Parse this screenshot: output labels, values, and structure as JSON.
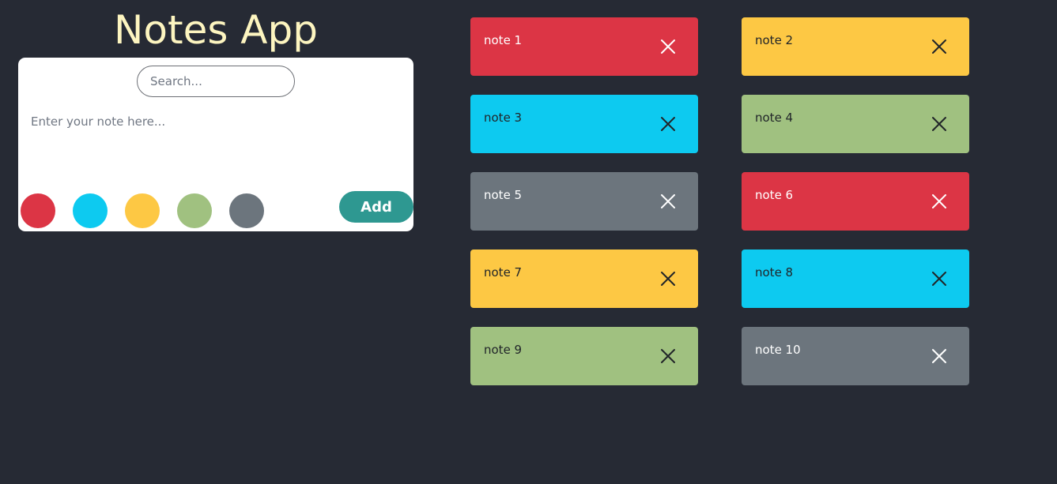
{
  "app": {
    "title": "Notes App"
  },
  "editor": {
    "search_placeholder": "Search...",
    "note_placeholder": "Enter your note here...",
    "add_label": "Add",
    "swatches": [
      {
        "name": "red",
        "color": "#dc3545"
      },
      {
        "name": "cyan",
        "color": "#0dcaf0"
      },
      {
        "name": "yellow",
        "color": "#fdc844"
      },
      {
        "name": "green",
        "color": "#a0c180"
      },
      {
        "name": "gray",
        "color": "#6c757d"
      }
    ]
  },
  "notes": [
    {
      "text": "note 1",
      "color": "#dc3545",
      "text_color": "#ffffff"
    },
    {
      "text": "note 2",
      "color": "#fdc844",
      "text_color": "#212529"
    },
    {
      "text": "note 3",
      "color": "#0dcaf0",
      "text_color": "#212529"
    },
    {
      "text": "note 4",
      "color": "#a0c180",
      "text_color": "#212529"
    },
    {
      "text": "note 5",
      "color": "#6c757d",
      "text_color": "#ffffff"
    },
    {
      "text": "note 6",
      "color": "#dc3545",
      "text_color": "#ffffff"
    },
    {
      "text": "note 7",
      "color": "#fdc844",
      "text_color": "#212529"
    },
    {
      "text": "note 8",
      "color": "#0dcaf0",
      "text_color": "#212529"
    },
    {
      "text": "note 9",
      "color": "#a0c180",
      "text_color": "#212529"
    },
    {
      "text": "note 10",
      "color": "#6c757d",
      "text_color": "#ffffff"
    }
  ],
  "icons": {
    "close": "close-icon"
  }
}
